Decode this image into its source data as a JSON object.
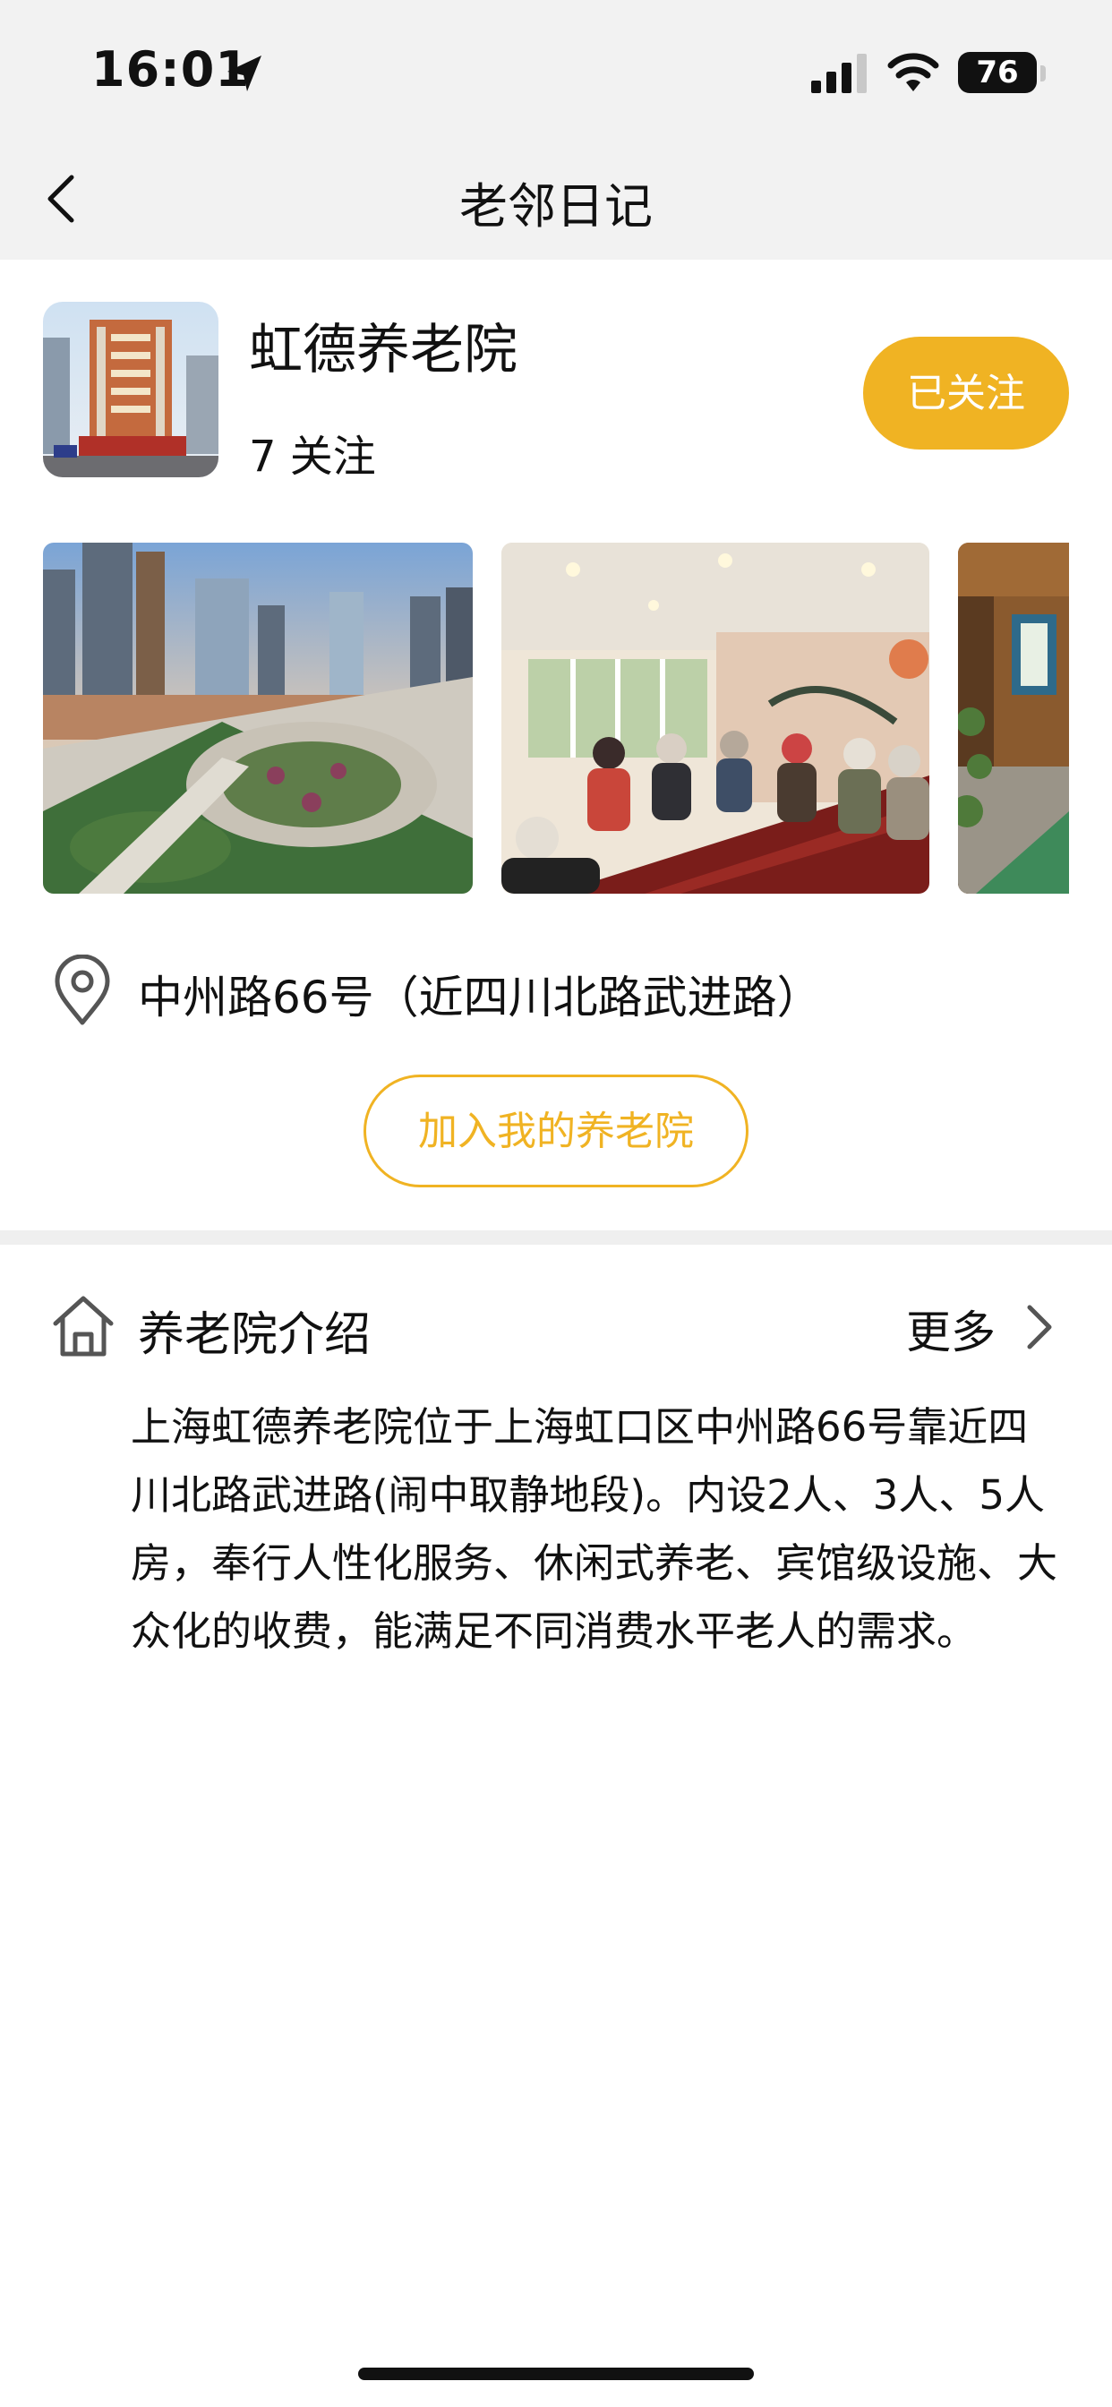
{
  "status_bar": {
    "time": "16:01",
    "battery": "76"
  },
  "nav": {
    "title": "老邻日记"
  },
  "home": {
    "name": "虹德养老院",
    "followers": "7 关注",
    "follow_button": "已关注",
    "address": "中州路66号（近四川北路武进路）",
    "join_button": "加入我的养老院"
  },
  "intro": {
    "title": "养老院介绍",
    "more": "更多",
    "text": "上海虹德养老院位于上海虹口区中州路66号靠近四川北路武进路(闹中取静地段)。内设2人、3人、5人房，奉行人性化服务、休闲式养老、宾馆级设施、大众化的收费，能满足不同消费水平老人的需求。"
  },
  "colors": {
    "accent": "#f0b323",
    "nav_background": "#f2f2f2"
  },
  "icons": [
    "location-arrow-icon",
    "signal-icon",
    "wifi-icon",
    "battery-icon",
    "back-icon",
    "map-pin-icon",
    "home-icon",
    "chevron-right-icon"
  ]
}
